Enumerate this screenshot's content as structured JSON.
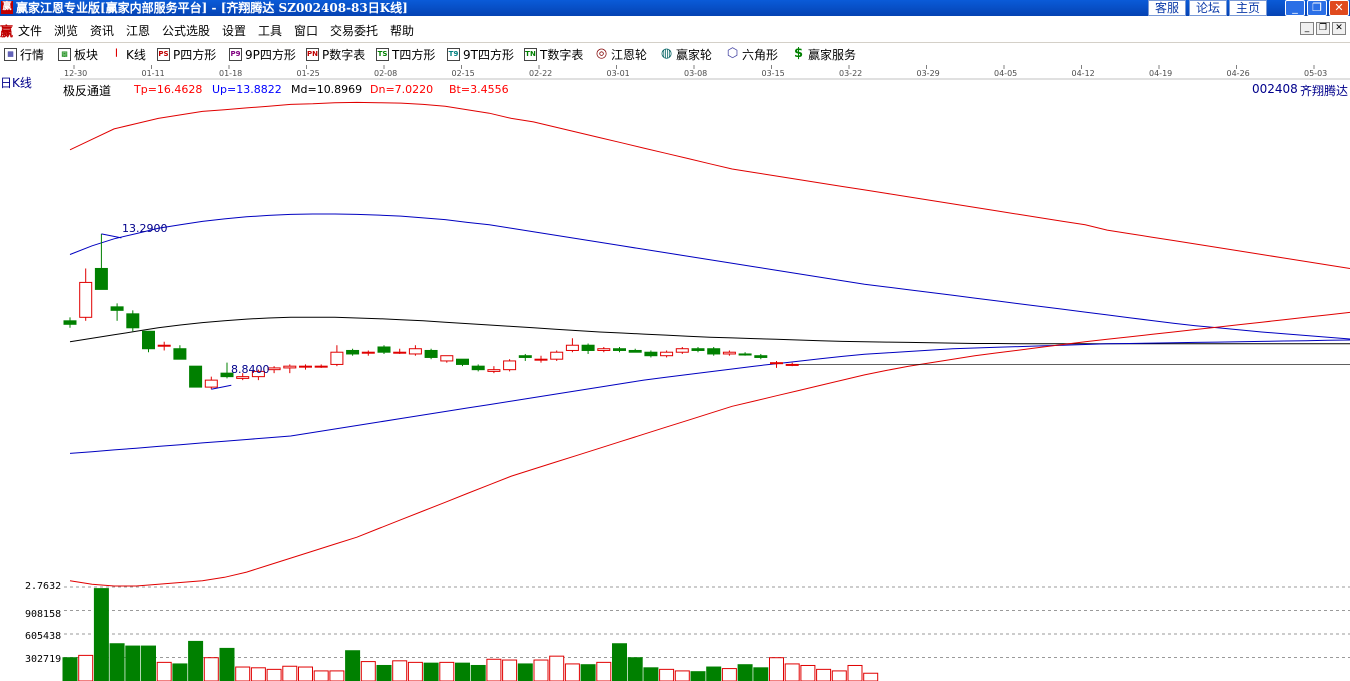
{
  "window": {
    "title": "赢家江恩专业版[赢家内部服务平台] - [齐翔腾达   SZ002408-83日K线]",
    "logo_glyph": "赢",
    "links": [
      "客服",
      "论坛",
      "主页"
    ],
    "controls": {
      "minimize": "_",
      "restore": "❐",
      "close": "✕"
    }
  },
  "menu": {
    "logo": "赢",
    "items": [
      "文件",
      "浏览",
      "资讯",
      "江恩",
      "公式选股",
      "设置",
      "工具",
      "窗口",
      "交易委托",
      "帮助"
    ]
  },
  "toolbar": {
    "items": [
      {
        "label": "行情",
        "icon": "grid-icon",
        "glyph": "▦"
      },
      {
        "label": "板块",
        "icon": "blocks-icon",
        "glyph": "▩"
      },
      {
        "label": "K线",
        "icon": "candlestick-icon",
        "glyph": "┃"
      },
      {
        "label": "P四方形",
        "icon": "ps-icon",
        "glyph": "PS"
      },
      {
        "label": "9P四方形",
        "icon": "p9-icon",
        "glyph": "P9"
      },
      {
        "label": "P数字表",
        "icon": "pn-icon",
        "glyph": "PN"
      },
      {
        "label": "T四方形",
        "icon": "ts-icon",
        "glyph": "TS"
      },
      {
        "label": "9T四方形",
        "icon": "t9-icon",
        "glyph": "T9"
      },
      {
        "label": "T数字表",
        "icon": "tn-icon",
        "glyph": "TN"
      },
      {
        "label": "江恩轮",
        "icon": "gann-wheel-icon",
        "glyph": "◎"
      },
      {
        "label": "赢家轮",
        "icon": "winner-wheel-icon",
        "glyph": "◍"
      },
      {
        "label": "六角形",
        "icon": "hexagon-icon",
        "glyph": "⬡"
      },
      {
        "label": "赢家服务",
        "icon": "dollar-icon",
        "glyph": "$"
      }
    ]
  },
  "chart_header": {
    "period_label": "日K线",
    "indicator_name": "极反通道",
    "indicator_values": [
      {
        "text": "Tp=16.4628",
        "color": "#ff0000"
      },
      {
        "text": "Up=13.8822",
        "color": "#0000ff"
      },
      {
        "text": "Md=10.8969",
        "color": "#000000"
      },
      {
        "text": "Dn=7.0220",
        "color": "#ff0000"
      },
      {
        "text": "Bt=3.4556",
        "color": "#ff0000"
      }
    ],
    "stock_code": "002408",
    "stock_name": "齐翔腾达"
  },
  "colors": {
    "up": "#e00000",
    "down": "#008000",
    "tp_line": "#e00000",
    "up_line": "#0000c0",
    "md_line": "#000000",
    "dn_line": "#0000c0",
    "bt_line": "#e00000"
  },
  "chart_data": {
    "type": "candlestick",
    "date_axis_labels": [
      "12-30",
      "01-11",
      "01-18",
      "01-25",
      "02-08",
      "02-15",
      "02-22",
      "03-01",
      "03-08",
      "03-15",
      "03-22",
      "03-29",
      "04-05",
      "04-12",
      "04-19",
      "04-26",
      "05-03"
    ],
    "price_range": [
      3.0,
      17.5
    ],
    "annotations": [
      {
        "text": "13.2900",
        "kind": "high",
        "candle_index": 2
      },
      {
        "text": "8.8400",
        "kind": "low",
        "candle_index": 9
      }
    ],
    "candles": [
      {
        "o": 10.8,
        "h": 10.9,
        "l": 10.6,
        "c": 10.7
      },
      {
        "o": 10.9,
        "h": 12.3,
        "l": 10.8,
        "c": 11.9
      },
      {
        "o": 12.3,
        "h": 13.29,
        "l": 12.2,
        "c": 11.7
      },
      {
        "o": 11.2,
        "h": 11.3,
        "l": 10.8,
        "c": 11.1
      },
      {
        "o": 11.0,
        "h": 11.1,
        "l": 10.5,
        "c": 10.6
      },
      {
        "o": 10.5,
        "h": 10.5,
        "l": 9.9,
        "c": 10.0
      },
      {
        "o": 10.1,
        "h": 10.2,
        "l": 9.95,
        "c": 10.1
      },
      {
        "o": 10.0,
        "h": 10.1,
        "l": 9.7,
        "c": 9.7
      },
      {
        "o": 9.5,
        "h": 9.5,
        "l": 8.9,
        "c": 8.9
      },
      {
        "o": 8.9,
        "h": 9.2,
        "l": 8.84,
        "c": 9.1
      },
      {
        "o": 9.3,
        "h": 9.6,
        "l": 9.15,
        "c": 9.2
      },
      {
        "o": 9.15,
        "h": 9.3,
        "l": 9.1,
        "c": 9.2
      },
      {
        "o": 9.2,
        "h": 9.4,
        "l": 9.1,
        "c": 9.35
      },
      {
        "o": 9.4,
        "h": 9.5,
        "l": 9.3,
        "c": 9.45
      },
      {
        "o": 9.45,
        "h": 9.55,
        "l": 9.3,
        "c": 9.5
      },
      {
        "o": 9.5,
        "h": 9.55,
        "l": 9.4,
        "c": 9.5
      },
      {
        "o": 9.5,
        "h": 9.55,
        "l": 9.45,
        "c": 9.5
      },
      {
        "o": 9.55,
        "h": 10.1,
        "l": 9.5,
        "c": 9.9
      },
      {
        "o": 9.95,
        "h": 10.0,
        "l": 9.8,
        "c": 9.85
      },
      {
        "o": 9.9,
        "h": 9.95,
        "l": 9.8,
        "c": 9.9
      },
      {
        "o": 10.05,
        "h": 10.1,
        "l": 9.85,
        "c": 9.9
      },
      {
        "o": 9.9,
        "h": 10.0,
        "l": 9.85,
        "c": 9.9
      },
      {
        "o": 9.85,
        "h": 10.1,
        "l": 9.8,
        "c": 10.0
      },
      {
        "o": 9.95,
        "h": 10.0,
        "l": 9.7,
        "c": 9.75
      },
      {
        "o": 9.65,
        "h": 9.8,
        "l": 9.6,
        "c": 9.8
      },
      {
        "o": 9.7,
        "h": 9.7,
        "l": 9.5,
        "c": 9.55
      },
      {
        "o": 9.5,
        "h": 9.55,
        "l": 9.35,
        "c": 9.4
      },
      {
        "o": 9.35,
        "h": 9.5,
        "l": 9.3,
        "c": 9.4
      },
      {
        "o": 9.4,
        "h": 9.7,
        "l": 9.35,
        "c": 9.65
      },
      {
        "o": 9.8,
        "h": 9.85,
        "l": 9.65,
        "c": 9.75
      },
      {
        "o": 9.7,
        "h": 9.8,
        "l": 9.6,
        "c": 9.7
      },
      {
        "o": 9.7,
        "h": 9.95,
        "l": 9.65,
        "c": 9.9
      },
      {
        "o": 9.95,
        "h": 10.3,
        "l": 9.9,
        "c": 10.1
      },
      {
        "o": 10.1,
        "h": 10.15,
        "l": 9.85,
        "c": 9.95
      },
      {
        "o": 9.95,
        "h": 10.05,
        "l": 9.9,
        "c": 10.0
      },
      {
        "o": 10.0,
        "h": 10.05,
        "l": 9.9,
        "c": 9.95
      },
      {
        "o": 9.95,
        "h": 10.0,
        "l": 9.9,
        "c": 9.9
      },
      {
        "o": 9.9,
        "h": 9.95,
        "l": 9.75,
        "c": 9.8
      },
      {
        "o": 9.8,
        "h": 9.95,
        "l": 9.75,
        "c": 9.9
      },
      {
        "o": 9.9,
        "h": 10.05,
        "l": 9.85,
        "c": 10.0
      },
      {
        "o": 10.0,
        "h": 10.05,
        "l": 9.9,
        "c": 9.95
      },
      {
        "o": 10.0,
        "h": 10.05,
        "l": 9.8,
        "c": 9.85
      },
      {
        "o": 9.85,
        "h": 9.95,
        "l": 9.8,
        "c": 9.9
      },
      {
        "o": 9.85,
        "h": 9.9,
        "l": 9.8,
        "c": 9.82
      },
      {
        "o": 9.8,
        "h": 9.85,
        "l": 9.7,
        "c": 9.75
      },
      {
        "o": 9.6,
        "h": 9.65,
        "l": 9.45,
        "c": 9.6
      },
      {
        "o": 9.55,
        "h": 9.6,
        "l": 9.5,
        "c": 9.55
      }
    ],
    "channels": {
      "Tp": [
        15.7,
        16.0,
        16.3,
        16.45,
        16.6,
        16.7,
        16.8,
        16.85,
        16.9,
        16.95,
        17.0,
        17.02,
        17.05,
        17.06,
        17.05,
        17.04,
        17.0,
        16.95,
        16.85,
        16.75,
        16.6,
        16.5,
        16.35,
        16.2,
        16.05,
        15.9,
        15.75,
        15.6,
        15.45,
        15.3,
        15.15,
        15.05,
        14.95,
        14.85,
        14.75,
        14.65,
        14.55,
        14.45,
        14.35,
        14.25,
        14.15,
        14.05,
        13.95,
        13.85,
        13.75,
        13.65,
        13.55,
        13.4,
        13.3,
        13.2,
        13.1,
        13.0,
        12.9,
        12.8,
        12.7,
        12.6,
        12.5,
        12.4,
        12.3
      ],
      "Up": [
        12.7,
        12.95,
        13.15,
        13.3,
        13.45,
        13.55,
        13.65,
        13.72,
        13.78,
        13.82,
        13.85,
        13.86,
        13.86,
        13.85,
        13.83,
        13.8,
        13.75,
        13.7,
        13.62,
        13.55,
        13.45,
        13.35,
        13.25,
        13.15,
        13.05,
        12.95,
        12.85,
        12.75,
        12.65,
        12.55,
        12.45,
        12.35,
        12.25,
        12.15,
        12.05,
        11.95,
        11.85,
        11.77,
        11.69,
        11.61,
        11.53,
        11.45,
        11.37,
        11.29,
        11.21,
        11.13,
        11.05,
        10.97,
        10.89,
        10.81,
        10.73,
        10.66,
        10.6,
        10.54,
        10.48,
        10.43,
        10.38,
        10.33,
        10.28
      ],
      "Md": [
        10.2,
        10.3,
        10.4,
        10.5,
        10.6,
        10.68,
        10.75,
        10.8,
        10.85,
        10.88,
        10.9,
        10.9,
        10.9,
        10.88,
        10.86,
        10.83,
        10.8,
        10.76,
        10.72,
        10.68,
        10.64,
        10.6,
        10.56,
        10.52,
        10.48,
        10.45,
        10.42,
        10.39,
        10.36,
        10.33,
        10.31,
        10.29,
        10.27,
        10.25,
        10.23,
        10.21,
        10.2,
        10.19,
        10.18,
        10.17,
        10.16,
        10.15,
        10.15,
        10.14,
        10.14,
        10.14,
        10.14,
        10.14,
        10.14,
        10.14,
        10.14,
        10.14,
        10.14,
        10.14,
        10.14,
        10.14,
        10.14,
        10.14,
        10.14
      ],
      "Dn": [
        7.0,
        7.05,
        7.1,
        7.15,
        7.2,
        7.25,
        7.3,
        7.35,
        7.4,
        7.45,
        7.5,
        7.6,
        7.7,
        7.8,
        7.9,
        8.0,
        8.1,
        8.2,
        8.3,
        8.4,
        8.5,
        8.6,
        8.7,
        8.8,
        8.9,
        9.0,
        9.1,
        9.18,
        9.26,
        9.34,
        9.42,
        9.5,
        9.57,
        9.64,
        9.71,
        9.78,
        9.84,
        9.88,
        9.92,
        9.96,
        10.0,
        10.02,
        10.04,
        10.06,
        10.08,
        10.1,
        10.12,
        10.14,
        10.15,
        10.16,
        10.17,
        10.18,
        10.19,
        10.2,
        10.21,
        10.22,
        10.23,
        10.24,
        10.25
      ],
      "Bt": [
        3.35,
        3.25,
        3.2,
        3.2,
        3.25,
        3.3,
        3.35,
        3.45,
        3.6,
        3.8,
        4.0,
        4.2,
        4.4,
        4.6,
        4.85,
        5.1,
        5.35,
        5.6,
        5.85,
        6.1,
        6.35,
        6.55,
        6.75,
        6.95,
        7.15,
        7.35,
        7.55,
        7.75,
        7.95,
        8.15,
        8.35,
        8.5,
        8.65,
        8.8,
        8.95,
        9.1,
        9.25,
        9.38,
        9.5,
        9.6,
        9.7,
        9.8,
        9.88,
        9.96,
        10.04,
        10.12,
        10.2,
        10.27,
        10.34,
        10.41,
        10.48,
        10.55,
        10.62,
        10.69,
        10.76,
        10.83,
        10.9,
        10.97,
        11.04
      ]
    },
    "volume": {
      "axis_labels": [
        "2.7632",
        "908158",
        "605438",
        "302719"
      ],
      "axis_values": [
        1210877,
        908158,
        605438,
        302719
      ],
      "values": [
        300000,
        330000,
        1190000,
        480000,
        450000,
        450000,
        240000,
        220000,
        510000,
        300000,
        420000,
        180000,
        170000,
        150000,
        190000,
        180000,
        130000,
        130000,
        390000,
        250000,
        200000,
        260000,
        240000,
        230000,
        240000,
        230000,
        200000,
        280000,
        270000,
        220000,
        270000,
        320000,
        220000,
        210000,
        240000,
        480000,
        300000,
        170000,
        150000,
        130000,
        120000,
        180000,
        160000,
        210000,
        170000,
        300000,
        220000,
        200000,
        150000,
        130000,
        200000,
        100000
      ]
    }
  }
}
